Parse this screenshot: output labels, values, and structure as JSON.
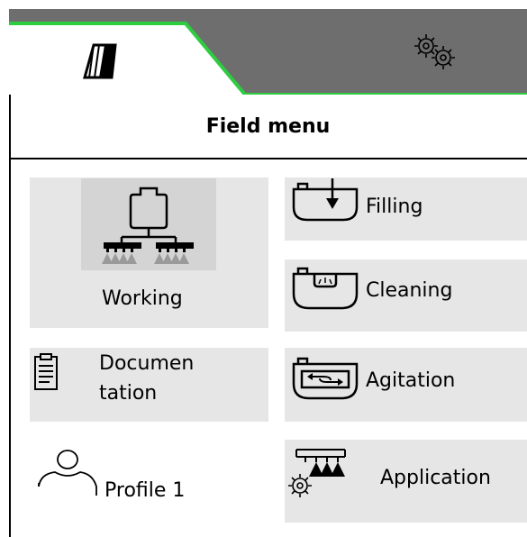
{
  "tabs": [
    {
      "name": "field",
      "icon": "field-icon",
      "active": true
    },
    {
      "name": "settings",
      "icon": "gears-icon",
      "active": false
    }
  ],
  "colors": {
    "accent": "#2ecc40",
    "tab_inactive": "#6e6e6e",
    "tile_bg": "#e6e6e6"
  },
  "header": {
    "title": "Field menu"
  },
  "menu": {
    "working": {
      "label": "Working",
      "icon": "sprayer-boom-icon"
    },
    "filling": {
      "label": "Filling",
      "icon": "tank-fill-icon"
    },
    "cleaning": {
      "label": "Cleaning",
      "icon": "tank-clean-icon"
    },
    "documentation": {
      "label_line1": "Documen",
      "label_line2": "tation",
      "icon": "clipboard-icon"
    },
    "agitation": {
      "label": "Agitation",
      "icon": "tank-agitation-icon"
    },
    "profile": {
      "label": "Profile 1",
      "icon": "user-profile-icon"
    },
    "application": {
      "label": "Application",
      "icon": "boom-gear-icon"
    }
  }
}
